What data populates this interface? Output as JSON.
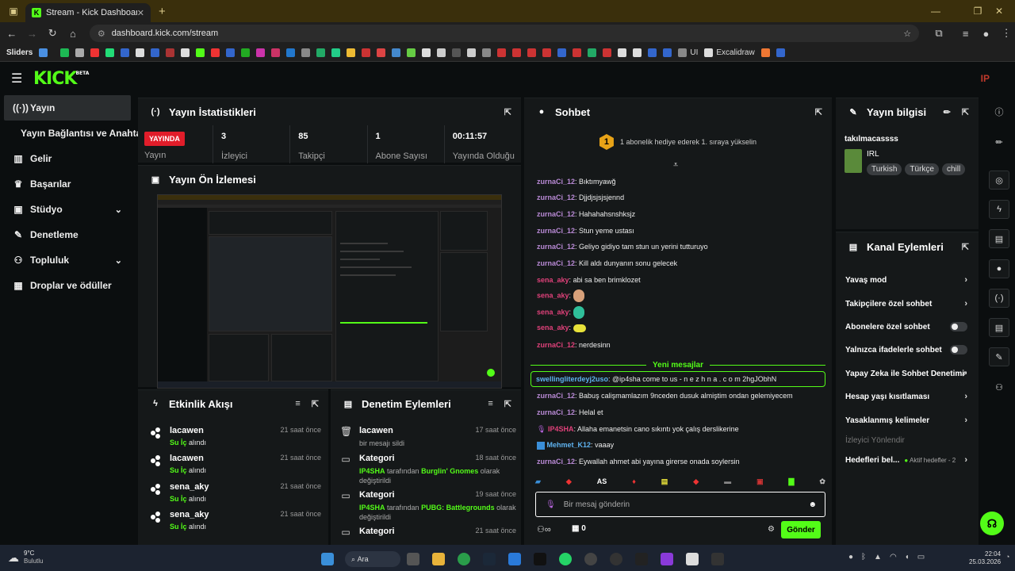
{
  "browser": {
    "tab_title": "Stream - Kick Dashboard",
    "url": "dashboard.kick.com/stream",
    "bookmarks_label": "Sliders",
    "bookmark_ui": "UI",
    "bookmark_excalidraw": "Excalidraw"
  },
  "app": {
    "logo": "KICK",
    "logo_sup": "BETA",
    "user_badge": "IP"
  },
  "sidebar": {
    "items": [
      {
        "label": "Yayın"
      },
      {
        "label": "Yayın Bağlantısı ve Anahtarı"
      },
      {
        "label": "Gelir"
      },
      {
        "label": "Başarılar"
      },
      {
        "label": "Stüdyo"
      },
      {
        "label": "Denetleme"
      },
      {
        "label": "Topluluk"
      },
      {
        "label": "Droplar ve ödüller"
      }
    ]
  },
  "stats": {
    "title": "Yayın İstatistikleri",
    "live_badge": "YAYINDA",
    "live_label": "Yayın",
    "items": [
      {
        "value": "3",
        "label": "İzleyici"
      },
      {
        "value": "85",
        "label": "Takipçi"
      },
      {
        "value": "1",
        "label": "Abone Sayısı"
      },
      {
        "value": "00:11:57",
        "label": "Yayında Olduğu"
      }
    ]
  },
  "preview": {
    "title": "Yayın Ön İzlemesi"
  },
  "activity": {
    "title": "Etkinlik Akışı",
    "items": [
      {
        "user": "lacawen",
        "action_hl": "Su İç",
        "action": "alındı",
        "time": "21 saat önce"
      },
      {
        "user": "lacawen",
        "action_hl": "Su İç",
        "action": "alındı",
        "time": "21 saat önce"
      },
      {
        "user": "sena_aky",
        "action_hl": "Su İç",
        "action": "alındı",
        "time": "21 saat önce"
      },
      {
        "user": "sena_aky",
        "action_hl": "Su İç",
        "action": "alındı",
        "time": "21 saat önce"
      }
    ]
  },
  "moderation": {
    "title": "Denetim Eylemleri",
    "items": [
      {
        "title": "lacawen",
        "desc": "bir mesajı sildi",
        "time": "17 saat önce"
      },
      {
        "title": "Kategori",
        "user": "IP4SHA",
        "mid": "tarafından",
        "game": "Burglin' Gnomes",
        "tail": "olarak değiştirildi",
        "time": "18 saat önce"
      },
      {
        "title": "Kategori",
        "user": "IP4SHA",
        "mid": "tarafından",
        "game": "PUBG: Battlegrounds",
        "tail": "olarak değiştirildi",
        "time": "19 saat önce"
      },
      {
        "title": "Kategori",
        "time": "21 saat önce"
      }
    ]
  },
  "chat": {
    "title": "Sohbet",
    "goal_badge": "1",
    "goal_text": "1 abonelik hediye ederek 1. sıraya yükselin",
    "messages": [
      {
        "user": "zurnaCi_12",
        "text": "Bıktımyawğ"
      },
      {
        "user": "zurnaCi_12",
        "text": "Djjdjsjsjsjennd"
      },
      {
        "user": "zurnaCi_12",
        "text": "Hahahahsnshksjz"
      },
      {
        "user": "zurnaCi_12",
        "text": "Stun yeme ustası"
      },
      {
        "user": "zurnaCi_12",
        "text": "Geliyo gidiyo tam stun un yerini tutturuyo"
      },
      {
        "user": "zurnaCi_12",
        "text": "Kill aldı dunyanın sonu gelecek"
      },
      {
        "user": "sena_aky",
        "text": "abi sa ben brimklozet"
      },
      {
        "user": "sena_aky",
        "text": ""
      },
      {
        "user": "sena_aky",
        "text": ""
      },
      {
        "user": "sena_aky",
        "text": ""
      },
      {
        "user": "zurnaCi_12",
        "text": "nerdesinn"
      }
    ],
    "new_messages": "Yeni mesajlar",
    "highlight": {
      "user": "swellingliterdeyj2uso",
      "text": "@ip4sha come to us - n e z h n a . c o m 2hgJObhN"
    },
    "messages2": [
      {
        "user": "zurnaCi_12",
        "text": "Babuş calişmamlazım 9nceden dusuk almiştim ondan gelemiyecem"
      },
      {
        "user": "zurnaCi_12",
        "text": "Helal et"
      },
      {
        "user": "IP4SHA",
        "text": "Allaha emanetsin cano sıkıntı yok çalış derslikerine"
      },
      {
        "user": "Mehmet_K12",
        "text": "vaaay"
      },
      {
        "user": "zurnaCi_12",
        "text": "Eywallah ahmet abi yayına girerse onada soylersin"
      }
    ],
    "emote_as": "AS",
    "input_placeholder": "Bir mesaj gönderin",
    "points": "0",
    "send_label": "Gönder"
  },
  "stream_info": {
    "title": "Yayın bilgisi",
    "stream_title": "takılmacassss",
    "category": "IRL",
    "tags": [
      "Turkish",
      "Türkçe",
      "chill"
    ]
  },
  "channel_actions": {
    "title": "Kanal Eylemleri",
    "slow_mode": "Yavaş mod",
    "followers_only": "Takipçilere özel sohbet",
    "subs_only": "Abonelere özel sohbet",
    "emotes_only": "Yalnızca ifadelerle sohbet",
    "ai_moderation": "Yapay Zeka ile Sohbet Denetimi",
    "age_restrictions": "Hesap yaşı kısıtlaması",
    "banned_words": "Yasaklanmış kelimeler",
    "viewer_redirect": "İzleyici Yönlendir",
    "goals": "Hedefleri bel...",
    "goals_active": "Aktif hedefler - 2"
  },
  "taskbar": {
    "weather_temp": "9°C",
    "weather_desc": "Bulutlu",
    "search": "Ara",
    "time": "22:04",
    "date": "25.03.2026"
  },
  "colors": {
    "accent": "#53fc18",
    "live": "#e11d2a",
    "bg": "#0b0e0f",
    "panel": "#151819"
  }
}
